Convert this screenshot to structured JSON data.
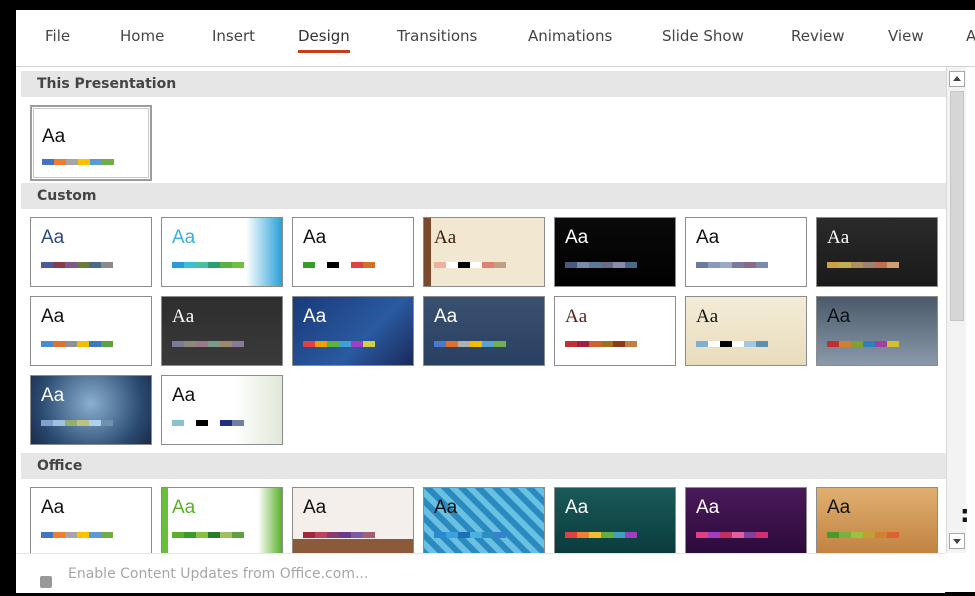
{
  "ribbon": {
    "tabs": [
      "File",
      "Home",
      "Insert",
      "Design",
      "Transitions",
      "Animations",
      "Slide Show",
      "Review",
      "View",
      "A"
    ],
    "active_tab": "Design",
    "accent_color": "#c43e1c"
  },
  "sections": {
    "this_presentation": "This Presentation",
    "custom": "Custom",
    "office": "Office"
  },
  "theme_glyph": "Aa",
  "footer": {
    "label": "Enable Content Updates from Office.com..."
  },
  "themes": {
    "current": {
      "bg": "#ffffff",
      "text": "#111111",
      "colors": [
        "#4472c4",
        "#ed7d31",
        "#a5a5a5",
        "#ffc000",
        "#5b9bd5",
        "#70ad47"
      ]
    },
    "custom": [
      {
        "bg": "linear-gradient(#ffffff,#ffffff)",
        "text": "#2a4a8a",
        "colors": [
          "#4a5b9b",
          "#8a3a4a",
          "#7a5a8a",
          "#6a7a3a",
          "#4a6a8a",
          "#8a8a8a"
        ],
        "serif": false
      },
      {
        "bg": "linear-gradient(90deg,#ffffff 70%,#2aa0d8 100%)",
        "text": "#3ab0e0",
        "colors": [
          "#2a9ad8",
          "#3ac0d0",
          "#4ac0a0",
          "#2aa070",
          "#5ab040",
          "#70c040"
        ],
        "serif": false
      },
      {
        "bg": "linear-gradient(#ffffff,#ffffff)",
        "text": "#111111",
        "colors": [
          "#3a9a2a",
          "#ffffff",
          "#000000",
          "#ffffff",
          "#e04040",
          "#d07020"
        ],
        "serif": false
      },
      {
        "bg": "linear-gradient(90deg,#7a4a2a 6%,#f2e8d2 6%)",
        "text": "#3a1a0a",
        "colors": [
          "#f0b0a0",
          "#ffffff",
          "#000000",
          "#ffffff",
          "#e08070",
          "#c0a080"
        ],
        "serif": true
      },
      {
        "bg": "linear-gradient(#0a0a0a,#000000)",
        "text": "#ffffff",
        "colors": [
          "#4a5a7a",
          "#7a8aaa",
          "#5a7a9a",
          "#6a6a8a",
          "#8a8aaa",
          "#4a6a8a"
        ],
        "serif": false
      },
      {
        "bg": "linear-gradient(#ffffff,#ffffff)",
        "text": "#111111",
        "colors": [
          "#6a7a9a",
          "#8a9aba",
          "#9aaac0",
          "#7a7a9a",
          "#8a6a8a",
          "#7a8aaa"
        ],
        "serif": false
      },
      {
        "bg": "linear-gradient(#2a2a2a,#1a1a1a)",
        "text": "#ffffff",
        "colors": [
          "#d0a040",
          "#c0b050",
          "#b09060",
          "#a08070",
          "#c07050",
          "#d0a070"
        ],
        "serif": true
      },
      {
        "bg": "linear-gradient(#ffffff,#ffffff)",
        "text": "#111111",
        "colors": [
          "#4a8ad0",
          "#e07030",
          "#909090",
          "#f0c000",
          "#3a7ac0",
          "#60a040"
        ],
        "serif": false
      },
      {
        "bg": "linear-gradient(#2e2e2e,#3a3a3a)",
        "text": "#ffffff",
        "colors": [
          "#7a7a9a",
          "#8a8a7a",
          "#9a7a8a",
          "#7a9a8a",
          "#9a8a6a",
          "#8a7a9a"
        ],
        "serif": true
      },
      {
        "bg": "linear-gradient(135deg,#1a3a7a,#2a5aa0 60%,#1a2a5a)",
        "text": "#ffffff",
        "colors": [
          "#e04040",
          "#f0a000",
          "#60b040",
          "#40a0d0",
          "#a040c0",
          "#d0d040"
        ],
        "serif": false
      },
      {
        "bg": "linear-gradient(#3a5070,#2a4060)",
        "text": "#ffffff",
        "colors": [
          "#4a7ad0",
          "#e07030",
          "#b0b0b0",
          "#f0c000",
          "#5aa0d0",
          "#70b050"
        ],
        "serif": false
      },
      {
        "bg": "linear-gradient(#ffffff,#ffffff)",
        "text": "#5a1a1a",
        "colors": [
          "#c03030",
          "#a02040",
          "#d06030",
          "#a07020",
          "#8a3a1a",
          "#c08040"
        ],
        "serif": true
      },
      {
        "bg": "linear-gradient(#f4ecd8,#e8dcbc)",
        "text": "#111111",
        "colors": [
          "#80b0d0",
          "#ffffff",
          "#000000",
          "#ffffff",
          "#a0c8e0",
          "#6090b0"
        ],
        "serif": true
      },
      {
        "bg": "linear-gradient(#4a5a6a,#8a9aaa)",
        "text": "#111111",
        "colors": [
          "#c03030",
          "#d08030",
          "#80a030",
          "#3080c0",
          "#a040a0",
          "#d0c030"
        ],
        "serif": false
      },
      {
        "bg": "radial-gradient(circle at 50% 40%,#8ab0d0,#2a4a70 70%,#1a2a4a)",
        "text": "#ffffff",
        "colors": [
          "#80a0d0",
          "#a0c0e0",
          "#90b070",
          "#c0c080",
          "#b0d0f0",
          "#7090b0"
        ],
        "serif": false
      },
      {
        "bg": "linear-gradient(90deg,#ffffff 60%,#e0e8d8 100%)",
        "text": "#111111",
        "colors": [
          "#8ac0d0",
          "#ffffff",
          "#000000",
          "#ffffff",
          "#203080",
          "#7080a0"
        ],
        "serif": false
      }
    ],
    "office": [
      {
        "bg": "linear-gradient(#ffffff,#ffffff)",
        "text": "#111111",
        "colors": [
          "#4472c4",
          "#ed7d31",
          "#a5a5a5",
          "#ffc000",
          "#5b9bd5",
          "#70ad47"
        ],
        "serif": false
      },
      {
        "bg": "linear-gradient(90deg,#6abf3a 5%,#ffffff 5%,#ffffff 80%,#5ab02a 100%)",
        "text": "#5ab02a",
        "colors": [
          "#5ab02a",
          "#3a9a2a",
          "#8ac040",
          "#2a7a2a",
          "#a0c060",
          "#60a040"
        ],
        "serif": false
      },
      {
        "bg": "linear-gradient(#f4efea 75%,#8a5a3a 75%)",
        "text": "#111111",
        "colors": [
          "#a02a3a",
          "#c04060",
          "#8a3a6a",
          "#6a3a8a",
          "#7a5aa0",
          "#a06070"
        ],
        "serif": false
      },
      {
        "bg": "repeating-linear-gradient(45deg,#2a8ac0 0 6px,#6ac0e0 6px 12px)",
        "text": "#111111",
        "colors": [
          "#2a8ad0",
          "#3aa0e0",
          "#1a70b0",
          "#4ab0e0",
          "#2a90c0",
          "#3a80d0"
        ],
        "serif": false
      },
      {
        "bg": "linear-gradient(#1a5a5a,#0a3a3a)",
        "text": "#ffffff",
        "colors": [
          "#e04040",
          "#f08030",
          "#f0c030",
          "#60b040",
          "#40a0c0",
          "#a040c0"
        ],
        "serif": false
      },
      {
        "bg": "linear-gradient(#4a1a5a,#2a0a3a)",
        "text": "#ffffff",
        "colors": [
          "#e04080",
          "#a040c0",
          "#c03060",
          "#e060a0",
          "#8040a0",
          "#d03070"
        ],
        "serif": false
      },
      {
        "bg": "linear-gradient(#e0b070,#c08040)",
        "text": "#111111",
        "colors": [
          "#4a9a2a",
          "#7ab040",
          "#a0c040",
          "#c0a030",
          "#d08030",
          "#e06030"
        ],
        "serif": false
      }
    ]
  }
}
